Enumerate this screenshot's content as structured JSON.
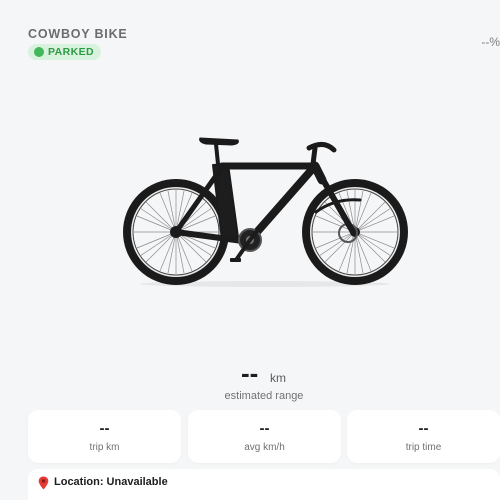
{
  "header": {
    "title": "COWBOY BIKE",
    "status": "PARKED",
    "battery": "--%"
  },
  "bike_image": {
    "icon": "bike-image",
    "color": "#1b1b1c"
  },
  "range": {
    "value": "--",
    "unit": "km",
    "caption": "estimated range"
  },
  "stats": [
    {
      "value": "--",
      "label": "trip km"
    },
    {
      "value": "--",
      "label": "avg km/h"
    },
    {
      "value": "--",
      "label": "trip time"
    }
  ],
  "location": {
    "icon": "map-pin-icon",
    "text": "Location: Unavailable"
  },
  "colors": {
    "background": "#f5f6f7",
    "card": "#ffffff",
    "status_bg": "#d8f2de",
    "status_green": "#42b85a"
  }
}
